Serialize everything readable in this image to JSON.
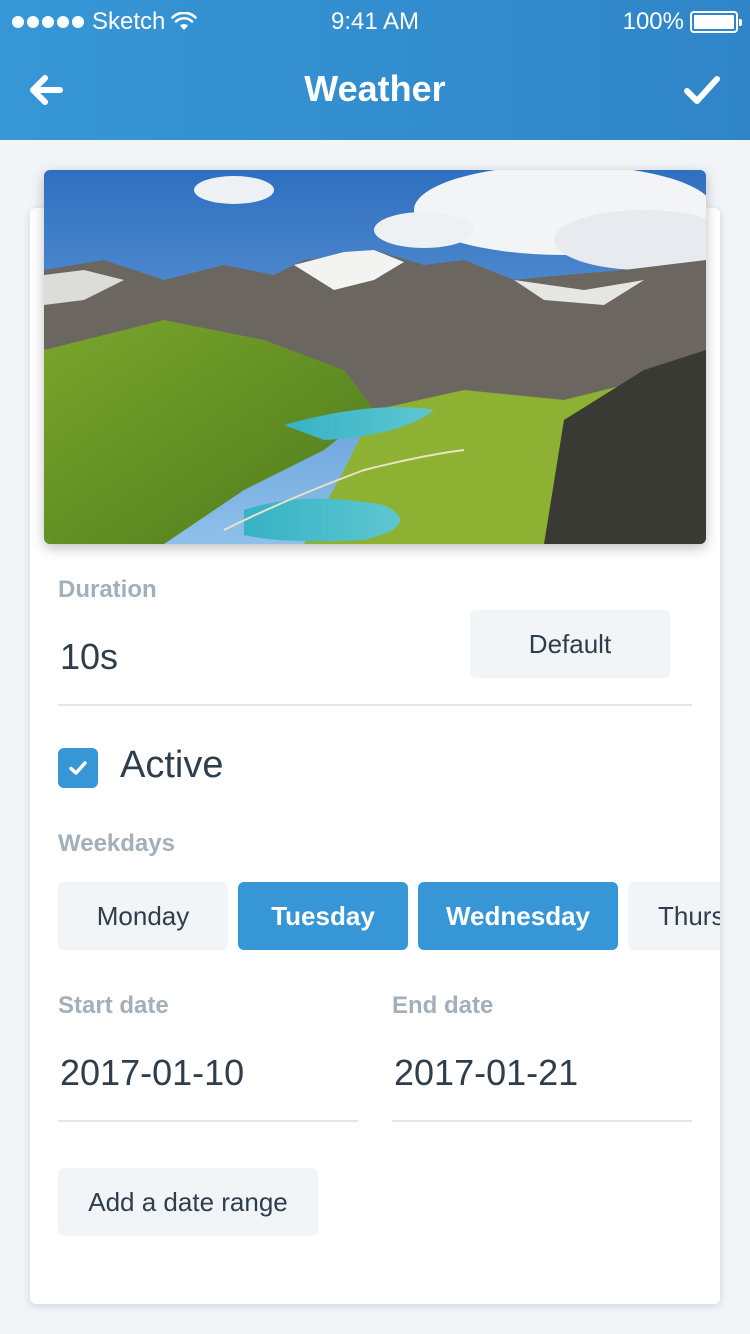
{
  "status_bar": {
    "carrier": "Sketch",
    "time": "9:41 AM",
    "battery": "100%"
  },
  "nav": {
    "title": "Weather",
    "back_icon": "arrow-left-icon",
    "confirm_icon": "checkmark-icon"
  },
  "duration": {
    "label": "Duration",
    "value": "10s",
    "default_button": "Default"
  },
  "active": {
    "label": "Active",
    "checked": true
  },
  "weekdays": {
    "label": "Weekdays",
    "days": [
      {
        "name": "Monday",
        "selected": false
      },
      {
        "name": "Tuesday",
        "selected": true
      },
      {
        "name": "Wednesday",
        "selected": true
      },
      {
        "name": "Thurs",
        "selected": false
      }
    ]
  },
  "dates": {
    "start_label": "Start date",
    "start_value": "2017-01-10",
    "end_label": "End date",
    "end_value": "2017-01-21",
    "add_range_button": "Add a date range"
  },
  "colors": {
    "accent": "#3797d6",
    "header_gradient_end": "#2f85c8",
    "background": "#f1f5f8",
    "label": "#a3b0ba",
    "text": "#2f3e4c"
  }
}
